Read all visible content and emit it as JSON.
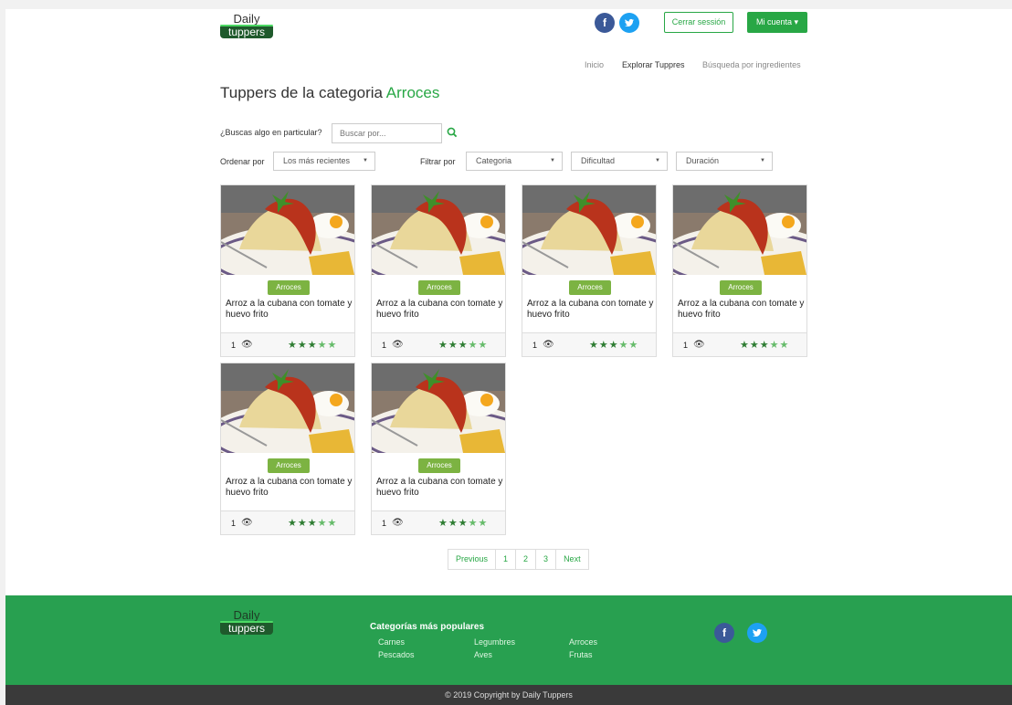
{
  "header": {
    "logo_top": "Daily",
    "logo_bottom": "tuppers",
    "facebook_glyph": "f",
    "twitter_glyph": "t",
    "logout_label": "Cerrar sessión",
    "account_label": "Mi cuenta ▾"
  },
  "nav": {
    "inicio": "Inicio",
    "explorar": "Explorar Tuppres",
    "busqueda": "Búsqueda por ingredientes"
  },
  "page": {
    "title_prefix": "Tuppers de la categoria",
    "title_category": "Arroces"
  },
  "search": {
    "label": "¿Buscas algo en particular?",
    "placeholder": "Buscar por..."
  },
  "sort": {
    "label": "Ordenar por",
    "value": "Los más recientes"
  },
  "filter": {
    "label": "Filtrar por",
    "categoria": "Categoria",
    "dificultad": "Dificultad",
    "duracion": "Duración"
  },
  "cards": [
    {
      "badge": "Arroces",
      "title": "Arroz a la cubana con tomate y huevo frito",
      "views": "1",
      "rating": 5
    },
    {
      "badge": "Arroces",
      "title": "Arroz a la cubana con tomate y huevo frito",
      "views": "1",
      "rating": 5
    },
    {
      "badge": "Arroces",
      "title": "Arroz a la cubana con tomate y huevo frito",
      "views": "1",
      "rating": 5
    },
    {
      "badge": "Arroces",
      "title": "Arroz a la cubana con tomate y huevo frito",
      "views": "1",
      "rating": 5
    },
    {
      "badge": "Arroces",
      "title": "Arroz a la cubana con tomate y huevo frito",
      "views": "1",
      "rating": 5
    },
    {
      "badge": "Arroces",
      "title": "Arroz a la cubana con tomate y huevo frito",
      "views": "1",
      "rating": 5
    }
  ],
  "pagination": {
    "previous": "Previous",
    "pages": [
      "1",
      "2",
      "3"
    ],
    "next": "Next"
  },
  "footer": {
    "logo_top": "Daily",
    "logo_bottom": "tuppers",
    "heading": "Categorías más populares",
    "categories": [
      "Carnes",
      "Legumbres",
      "Arroces",
      "Pescados",
      "Aves",
      "Frutas"
    ],
    "copyright": "© 2019 Copyright by Daily Tuppers"
  },
  "colors": {
    "brand_green": "#28a745",
    "footer_green": "#28a050",
    "badge_green": "#7cb342",
    "facebook": "#3b5998",
    "twitter": "#1da1f2"
  },
  "icons": [
    "facebook-icon",
    "twitter-icon",
    "search-icon",
    "eye-icon",
    "star-icon",
    "caret-down-icon"
  ]
}
